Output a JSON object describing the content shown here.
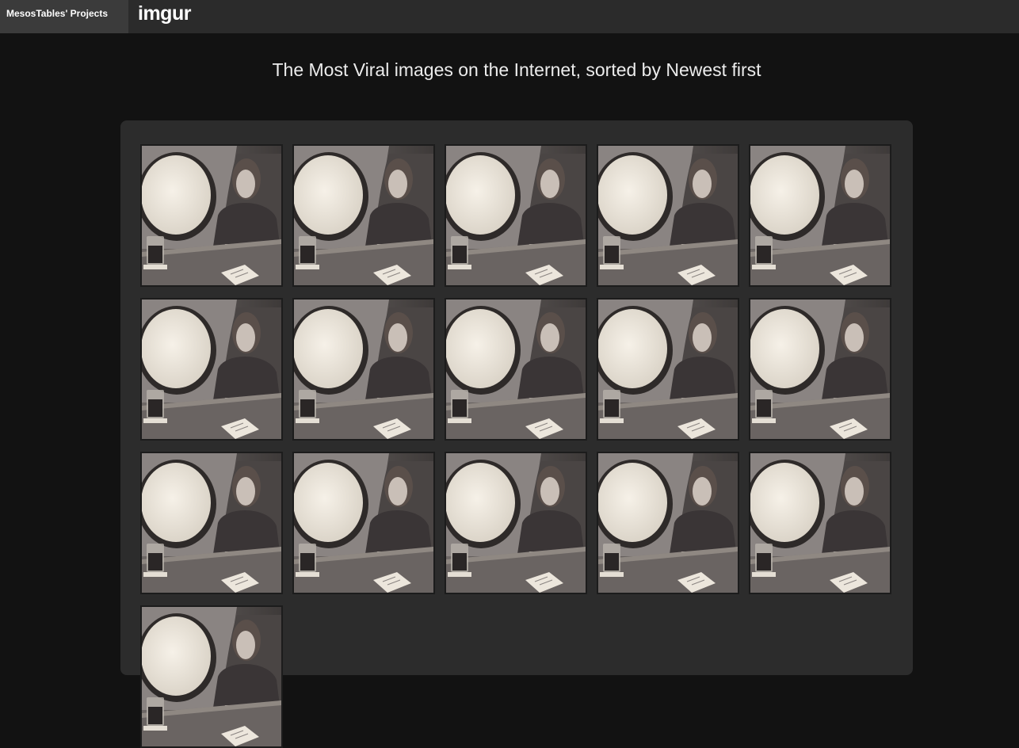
{
  "header": {
    "projects_label": "MesosTables' Projects",
    "logo_text": "imgur"
  },
  "main": {
    "headline": "The Most Viral images on the Internet, sorted by Newest first"
  },
  "gallery": {
    "columns": 5,
    "count": 16,
    "image_subject": "woman-on-airplane-photo"
  }
}
